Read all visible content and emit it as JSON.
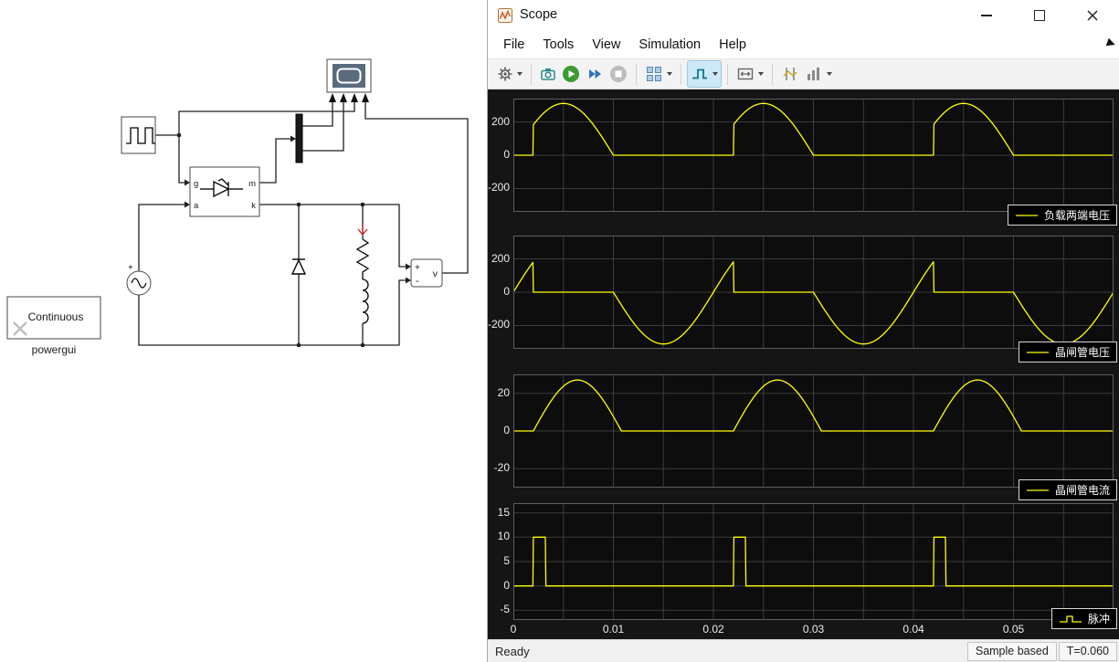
{
  "window": {
    "title": "Scope"
  },
  "menu": {
    "items": [
      "File",
      "Tools",
      "View",
      "Simulation",
      "Help"
    ]
  },
  "toolbar": {
    "icons": [
      "settings-gear",
      "snapshot-camera",
      "run-play",
      "step-forward",
      "stop",
      "layout-grid",
      "trigger",
      "span-x",
      "cursor-measurements",
      "signal-statistics"
    ]
  },
  "status_bar": {
    "left": "Ready",
    "sample_mode": "Sample based",
    "sim_time": "T=0.060"
  },
  "diagram": {
    "powergui": {
      "mode": "Continuous",
      "label": "powergui"
    },
    "thyristor_ports": {
      "g": "g",
      "a": "a",
      "m": "m",
      "k": "k"
    },
    "vm": {
      "plus": "+",
      "minus": "-",
      "label": "v"
    },
    "source": {
      "plus": "+"
    }
  },
  "colors": {
    "trace": "#ffff00",
    "axes_bg": "#0d0d0d",
    "grid": "#3c3c3c",
    "play_green": "#3d9a35",
    "step_blue": "#2e75b6"
  },
  "chart_data": {
    "type": "line",
    "x_range": [
      0,
      0.06
    ],
    "x_grid_step": 0.005,
    "x_ticks": [
      {
        "v": 0,
        "label": "0"
      },
      {
        "v": 0.01,
        "label": "0.01"
      },
      {
        "v": 0.02,
        "label": "0.02"
      },
      {
        "v": 0.03,
        "label": "0.03"
      },
      {
        "v": 0.04,
        "label": "0.04"
      },
      {
        "v": 0.05,
        "label": "0.05"
      }
    ],
    "trace_color": "#ffff00",
    "plots": [
      {
        "name": "load-voltage",
        "legend": "负载两端电压",
        "legend_sample": "line",
        "ylim": [
          -340,
          340
        ],
        "yticks": [
          {
            "v": 200,
            "label": "200"
          },
          {
            "v": 0,
            "label": "0"
          },
          {
            "v": -200,
            "label": "-200"
          }
        ],
        "waveform": {
          "kind": "gated_half_sine",
          "amplitude": 311,
          "frequency": 50,
          "fire_time": 0.002
        }
      },
      {
        "name": "thyristor-voltage",
        "legend": "晶闸管电压",
        "legend_sample": "line",
        "ylim": [
          -340,
          340
        ],
        "yticks": [
          {
            "v": 200,
            "label": "200"
          },
          {
            "v": 0,
            "label": "0"
          },
          {
            "v": -200,
            "label": "-200"
          }
        ],
        "waveform": {
          "kind": "blocking_voltage",
          "amplitude": 311,
          "frequency": 50,
          "fire_time": 0.002
        }
      },
      {
        "name": "thyristor-current",
        "legend": "晶闸管电流",
        "legend_sample": "line",
        "ylim": [
          -30,
          30
        ],
        "yticks": [
          {
            "v": 20,
            "label": "20"
          },
          {
            "v": 0,
            "label": "0"
          },
          {
            "v": -20,
            "label": "-20"
          }
        ],
        "waveform": {
          "kind": "half_sine_hump",
          "amplitude": 27,
          "frequency": 50,
          "fire_time": 0.002,
          "extinction_time": 0.0108
        }
      },
      {
        "name": "pulse",
        "legend": "脉冲",
        "legend_sample": "step",
        "ylim": [
          -7,
          17
        ],
        "yticks": [
          {
            "v": 15,
            "label": "15"
          },
          {
            "v": 10,
            "label": "10"
          },
          {
            "v": 5,
            "label": "5"
          },
          {
            "v": 0,
            "label": "0"
          },
          {
            "v": -5,
            "label": "-5"
          }
        ],
        "waveform": {
          "kind": "pulse_train",
          "amplitude": 10,
          "frequency": 50,
          "fire_time": 0.002,
          "width": 0.0012
        }
      }
    ]
  }
}
